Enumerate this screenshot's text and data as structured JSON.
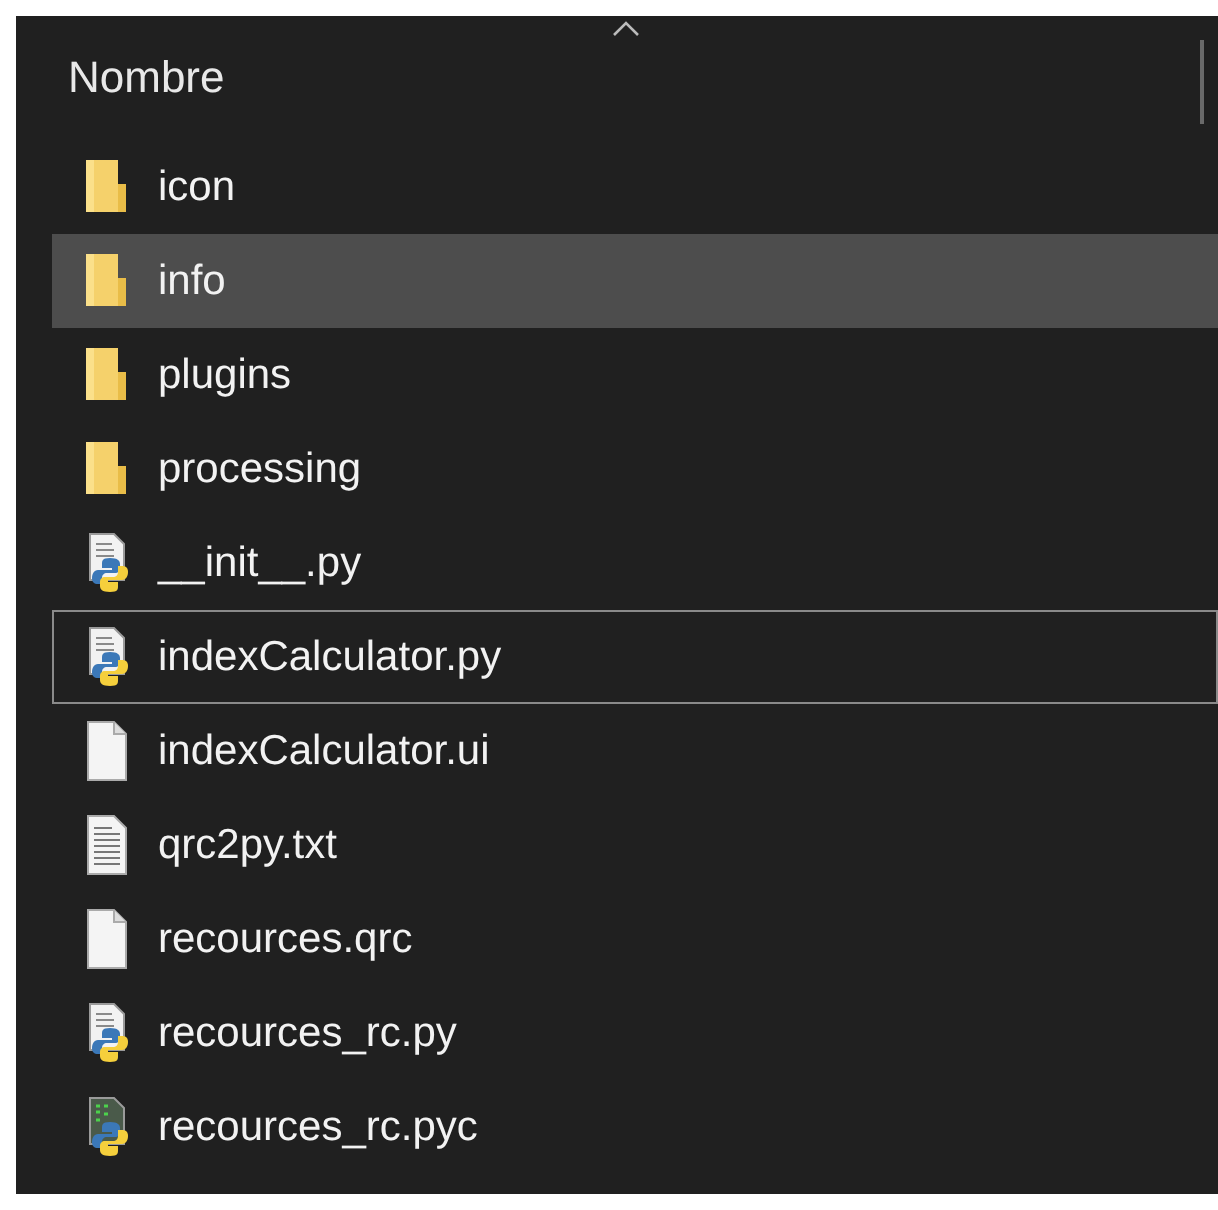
{
  "header": {
    "column": "Nombre"
  },
  "files": [
    {
      "name": "icon",
      "kind": "folder",
      "hovered": false,
      "focused": false
    },
    {
      "name": "info",
      "kind": "folder",
      "hovered": true,
      "focused": false
    },
    {
      "name": "plugins",
      "kind": "folder",
      "hovered": false,
      "focused": false
    },
    {
      "name": "processing",
      "kind": "folder",
      "hovered": false,
      "focused": false
    },
    {
      "name": "__init__.py",
      "kind": "python",
      "hovered": false,
      "focused": false
    },
    {
      "name": "indexCalculator.py",
      "kind": "python",
      "hovered": false,
      "focused": true
    },
    {
      "name": "indexCalculator.ui",
      "kind": "file",
      "hovered": false,
      "focused": false
    },
    {
      "name": "qrc2py.txt",
      "kind": "text",
      "hovered": false,
      "focused": false
    },
    {
      "name": "recources.qrc",
      "kind": "file",
      "hovered": false,
      "focused": false
    },
    {
      "name": "recources_rc.py",
      "kind": "python",
      "hovered": false,
      "focused": false
    },
    {
      "name": "recources_rc.pyc",
      "kind": "compiled",
      "hovered": false,
      "focused": false
    }
  ]
}
